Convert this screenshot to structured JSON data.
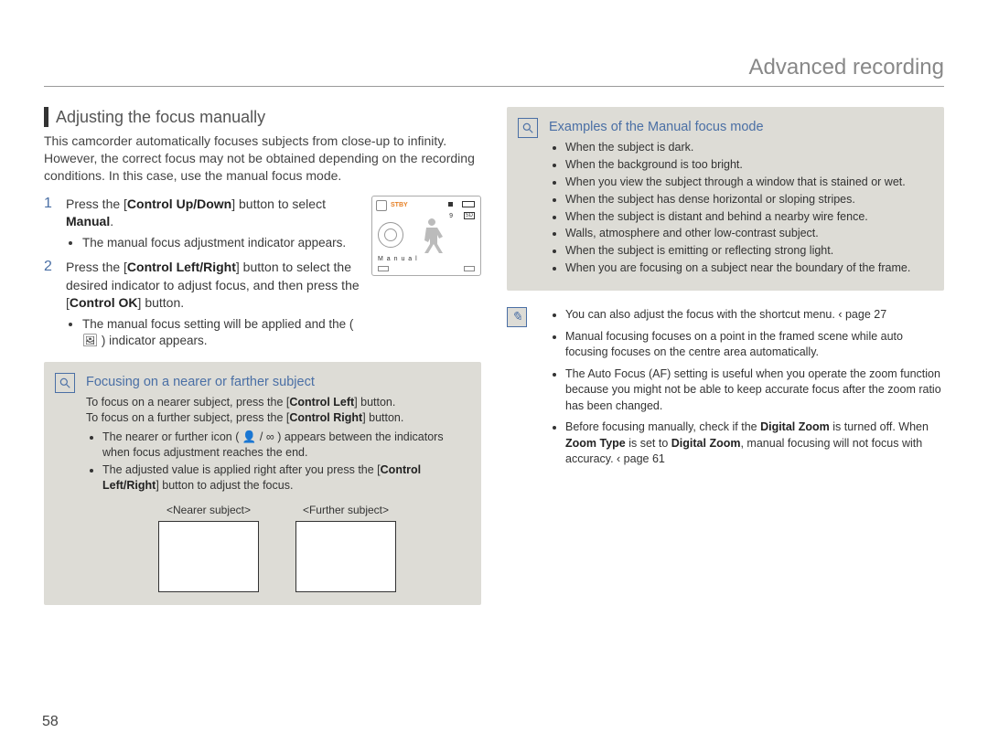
{
  "page_header": "Advanced recording",
  "page_number": "58",
  "left": {
    "section_title": "Adjusting the focus manually",
    "intro": "This camcorder automatically focuses subjects from close-up to infinity. However, the correct focus may not be obtained depending on the recording conditions. In this case, use the manual focus mode.",
    "lcd": {
      "stby": "STBY",
      "nine": "9",
      "sd": "SD",
      "manual": "M a n u a l"
    },
    "steps": [
      {
        "n": "1",
        "pre": "Press the [",
        "bold": "Control Up/Down",
        "post1": "] button to select ",
        "bold2": "Manual",
        "post2": ".",
        "bullets": [
          "The manual focus adjustment indicator appears."
        ]
      },
      {
        "n": "2",
        "pre": "Press the [",
        "bold": "Control Left/Right",
        "post1": "] button to select the desired indicator to adjust focus, and then press the [",
        "bold2": "Control OK",
        "post2": "] button.",
        "bullets": [
          "The manual focus setting will be applied and the ( 🖼 ) indicator appears."
        ]
      }
    ],
    "panel": {
      "title": "Focusing on a nearer or farther subject",
      "line1_pre": "To focus on a nearer subject, press the [",
      "line1_bold": "Control Left",
      "line1_post": "] button.",
      "line2_pre": "To focus on a further subject, press the [",
      "line2_bold": "Control Right",
      "line2_post": "] button.",
      "bullets": [
        "The nearer or further icon ( 👤 / ∞ ) appears between the indicators when focus adjustment reaches the end.",
        "The adjusted value is applied right after you press the [Control Left/Right] button to adjust the focus."
      ],
      "thumbs": {
        "near": "<Nearer subject>",
        "far": "<Further subject>"
      }
    }
  },
  "right": {
    "panel": {
      "title": "Examples of the Manual focus mode",
      "bullets": [
        "When the subject is dark.",
        "When the background is too bright.",
        "When you view the subject through a window that is stained or wet.",
        "When the subject has dense horizontal or sloping stripes.",
        "When the subject is distant and behind a nearby wire fence.",
        "Walls, atmosphere and other low-contrast subject.",
        "When the subject is emitting or reflecting strong light.",
        "When you are focusing on a subject near the boundary of the frame."
      ]
    },
    "notes": [
      {
        "text": "You can also adjust the focus with the shortcut menu.  ‹ page 27"
      },
      {
        "text": "Manual focusing focuses on a point in the framed scene while auto focusing focuses on the centre area automatically."
      },
      {
        "text": "The Auto Focus (AF) setting is useful when you operate the zoom function because you might not be able to keep accurate focus after the zoom ratio has been changed."
      },
      {
        "html": "Before focusing manually, check if the <b>Digital Zoom</b> is turned off. When <b>Zoom Type</b> is set to <b>Digital Zoom</b>, manual focusing will not focus with accuracy.  ‹ page 61"
      }
    ]
  }
}
